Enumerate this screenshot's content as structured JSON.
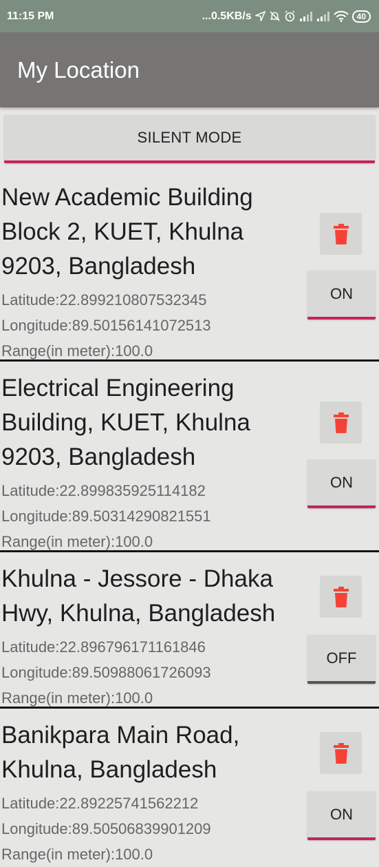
{
  "status_bar": {
    "time": "11:15 PM",
    "network_speed": "...0.5KB/s",
    "battery": "40"
  },
  "app_bar": {
    "title": "My Location"
  },
  "silent_button": {
    "label": "SILENT MODE"
  },
  "locations": [
    {
      "address": "New Academic Building Block 2, KUET, Khulna 9203, Bangladesh",
      "latitude": "Latitude:22.899210807532345",
      "longitude": "Longitude:89.50156141072513",
      "range": "Range(in meter):100.0",
      "toggle": "ON"
    },
    {
      "address": "Electrical Engineering Building, KUET, Khulna 9203, Bangladesh",
      "latitude": "Latitude:22.899835925114182",
      "longitude": "Longitude:89.50314290821551",
      "range": "Range(in meter):100.0",
      "toggle": "ON"
    },
    {
      "address": "Khulna - Jessore - Dhaka Hwy, Khulna, Bangladesh",
      "latitude": "Latitude:22.896796171161846",
      "longitude": "Longitude:89.50988061726093",
      "range": "Range(in meter):100.0",
      "toggle": "OFF"
    },
    {
      "address": "Banikpara Main Road, Khulna, Bangladesh",
      "latitude": "Latitude:22.89225741562212",
      "longitude": "Longitude:89.50506839901209",
      "range": "Range(in meter):100.0",
      "toggle": "ON"
    }
  ],
  "colors": {
    "status_bar": "#7c8e7f",
    "app_bar": "#767574",
    "accent": "#c2245e",
    "delete_icon": "#f44336"
  },
  "icons": [
    "delete-icon",
    "wifi-icon",
    "signal-icon",
    "alarm-icon",
    "mute-icon",
    "location-arrow-icon",
    "battery-icon"
  ]
}
